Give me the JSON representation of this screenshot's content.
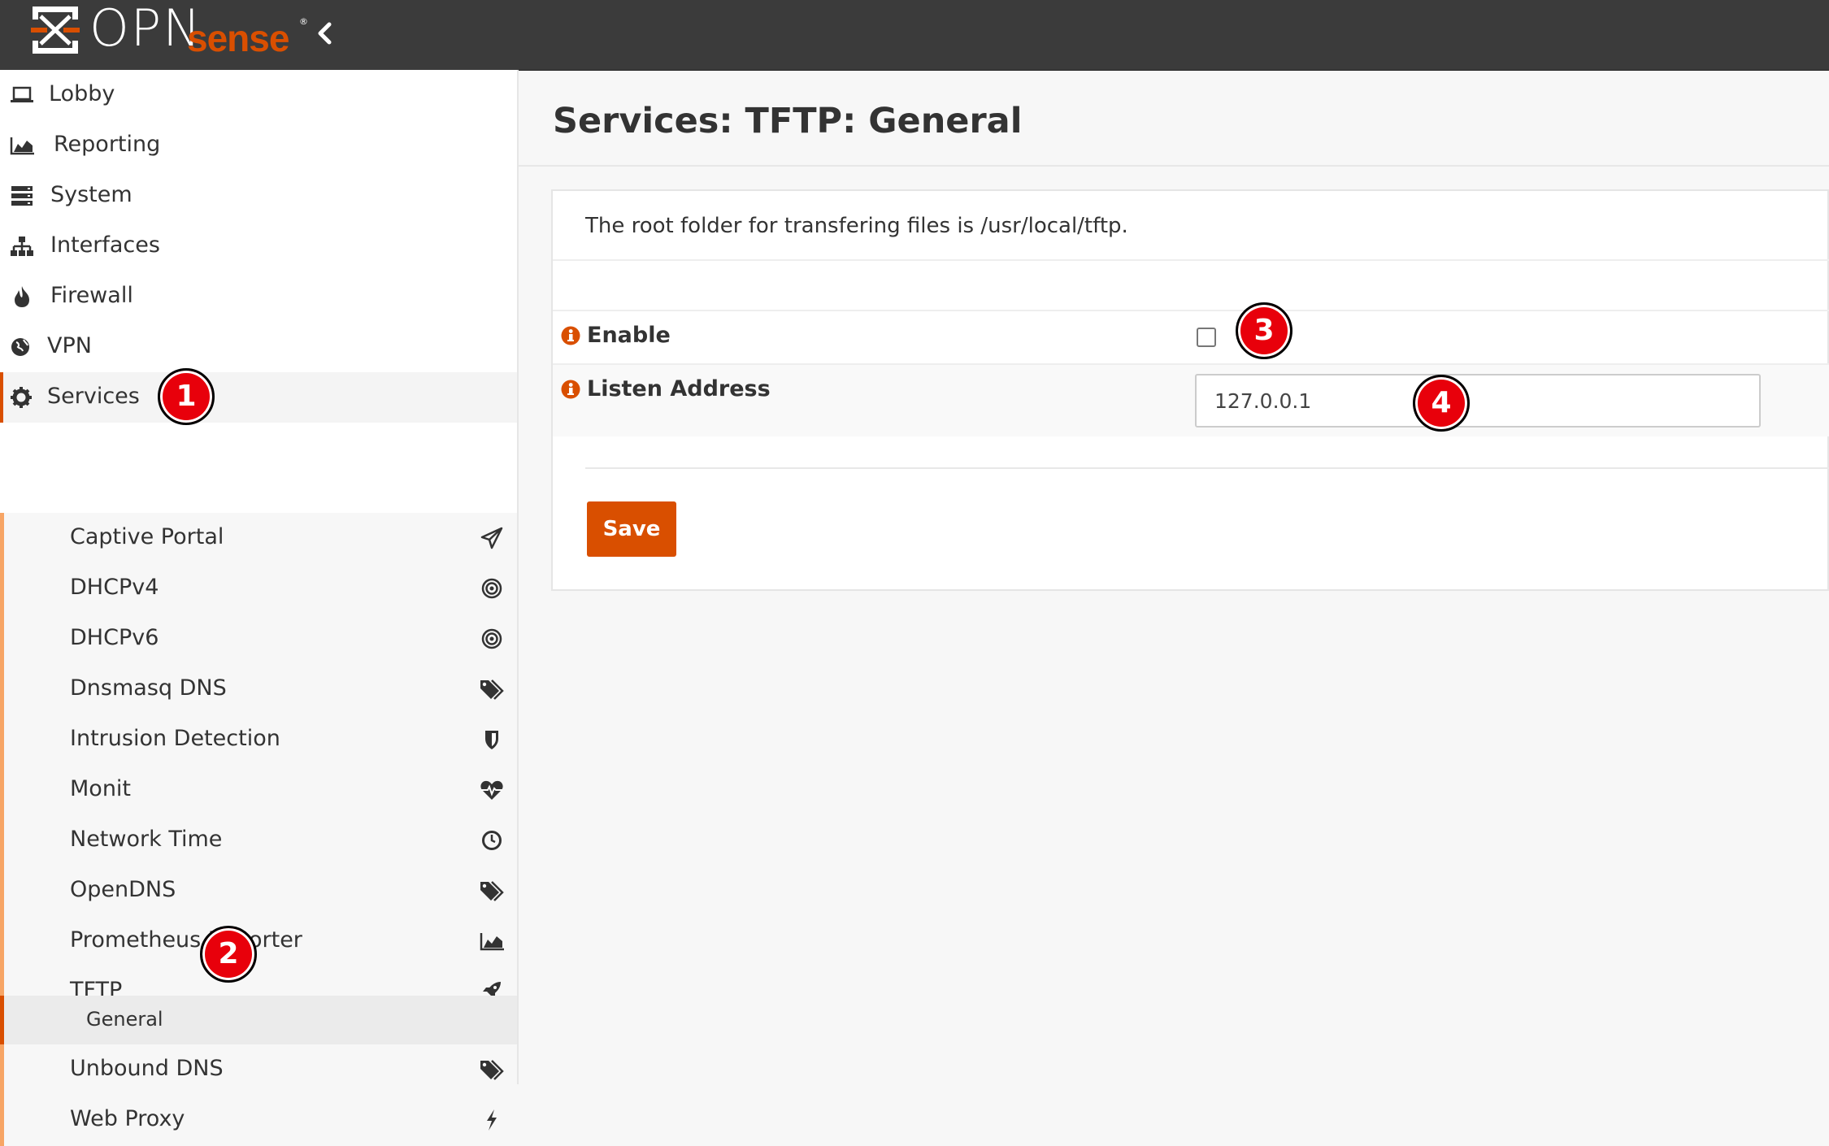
{
  "brand": {
    "main": "OPN",
    "accent": "sense",
    "mark": "®",
    "accent_color": "#d94f00",
    "header_bg": "#3b3b3b"
  },
  "nav": [
    {
      "label": "Lobby",
      "icon": "laptop-icon"
    },
    {
      "label": "Reporting",
      "icon": "area-chart-icon"
    },
    {
      "label": "System",
      "icon": "server-icon"
    },
    {
      "label": "Interfaces",
      "icon": "sitemap-icon"
    },
    {
      "label": "Firewall",
      "icon": "fire-icon"
    },
    {
      "label": "VPN",
      "icon": "globe-icon"
    },
    {
      "label": "Services",
      "icon": "gear-icon",
      "active": true
    }
  ],
  "services_menu": [
    {
      "label": "Captive Portal",
      "icon": "paper-plane-icon"
    },
    {
      "label": "DHCPv4",
      "icon": "bullseye-icon"
    },
    {
      "label": "DHCPv6",
      "icon": "bullseye-icon"
    },
    {
      "label": "Dnsmasq DNS",
      "icon": "tags-icon"
    },
    {
      "label": "Intrusion Detection",
      "icon": "shield-icon"
    },
    {
      "label": "Monit",
      "icon": "heartbeat-icon"
    },
    {
      "label": "Network Time",
      "icon": "clock-icon"
    },
    {
      "label": "OpenDNS",
      "icon": "tags-icon"
    },
    {
      "label": "Prometheus Exporter",
      "icon": "area-chart-icon"
    },
    {
      "label": "TFTP",
      "icon": "rocket-icon"
    },
    {
      "label": "Unbound DNS",
      "icon": "tags-icon"
    },
    {
      "label": "Web Proxy",
      "icon": "bolt-icon"
    }
  ],
  "tftp_submenu": {
    "label": "General",
    "active": true
  },
  "page": {
    "title": "Services: TFTP: General",
    "info": "The root folder for transfering files is /usr/local/tftp."
  },
  "form": {
    "enable": {
      "label": "Enable",
      "checked": false
    },
    "listen_address": {
      "label": "Listen Address",
      "value": "127.0.0.1"
    },
    "save_label": "Save"
  },
  "annotations": [
    "1",
    "2",
    "3",
    "4"
  ]
}
